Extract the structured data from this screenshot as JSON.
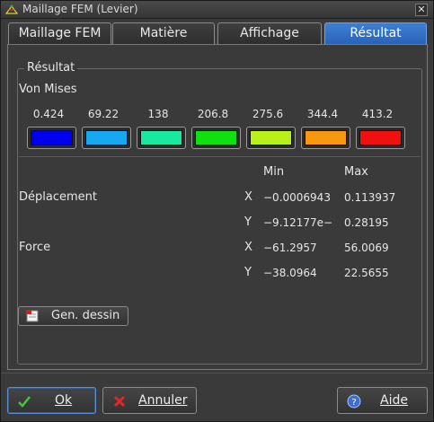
{
  "window": {
    "title": "Maillage FEM (Levier)"
  },
  "tabs": [
    {
      "label": "Maillage FEM",
      "active": false
    },
    {
      "label": "Matière",
      "active": false
    },
    {
      "label": "Affichage",
      "active": false
    },
    {
      "label": "Résultat",
      "active": true
    }
  ],
  "result": {
    "group_title": "Résultat",
    "subtitle": "Von Mises",
    "legend": [
      {
        "value": "0.424",
        "color": "#0000f0"
      },
      {
        "value": "69.22",
        "color": "#16a8f0"
      },
      {
        "value": "138",
        "color": "#18e8a0"
      },
      {
        "value": "206.8",
        "color": "#10e010"
      },
      {
        "value": "275.6",
        "color": "#b8f018"
      },
      {
        "value": "344.4",
        "color": "#f89810"
      },
      {
        "value": "413.2",
        "color": "#f01010"
      }
    ],
    "columns": {
      "min": "Min",
      "max": "Max"
    },
    "rows": [
      {
        "label": "Déplacement",
        "axis": "X",
        "min": "−0.0006943",
        "max": "0.113937"
      },
      {
        "label": "",
        "axis": "Y",
        "min": "−9.12177e−",
        "max": "0.28195"
      },
      {
        "label": "Force",
        "axis": "X",
        "min": "−61.2957",
        "max": "56.0069"
      },
      {
        "label": "",
        "axis": "Y",
        "min": "−38.0964",
        "max": "22.5655"
      }
    ],
    "gen_button": "Gen. dessin"
  },
  "buttons": {
    "ok": "Ok",
    "cancel": "Annuler",
    "help": "Aide"
  }
}
